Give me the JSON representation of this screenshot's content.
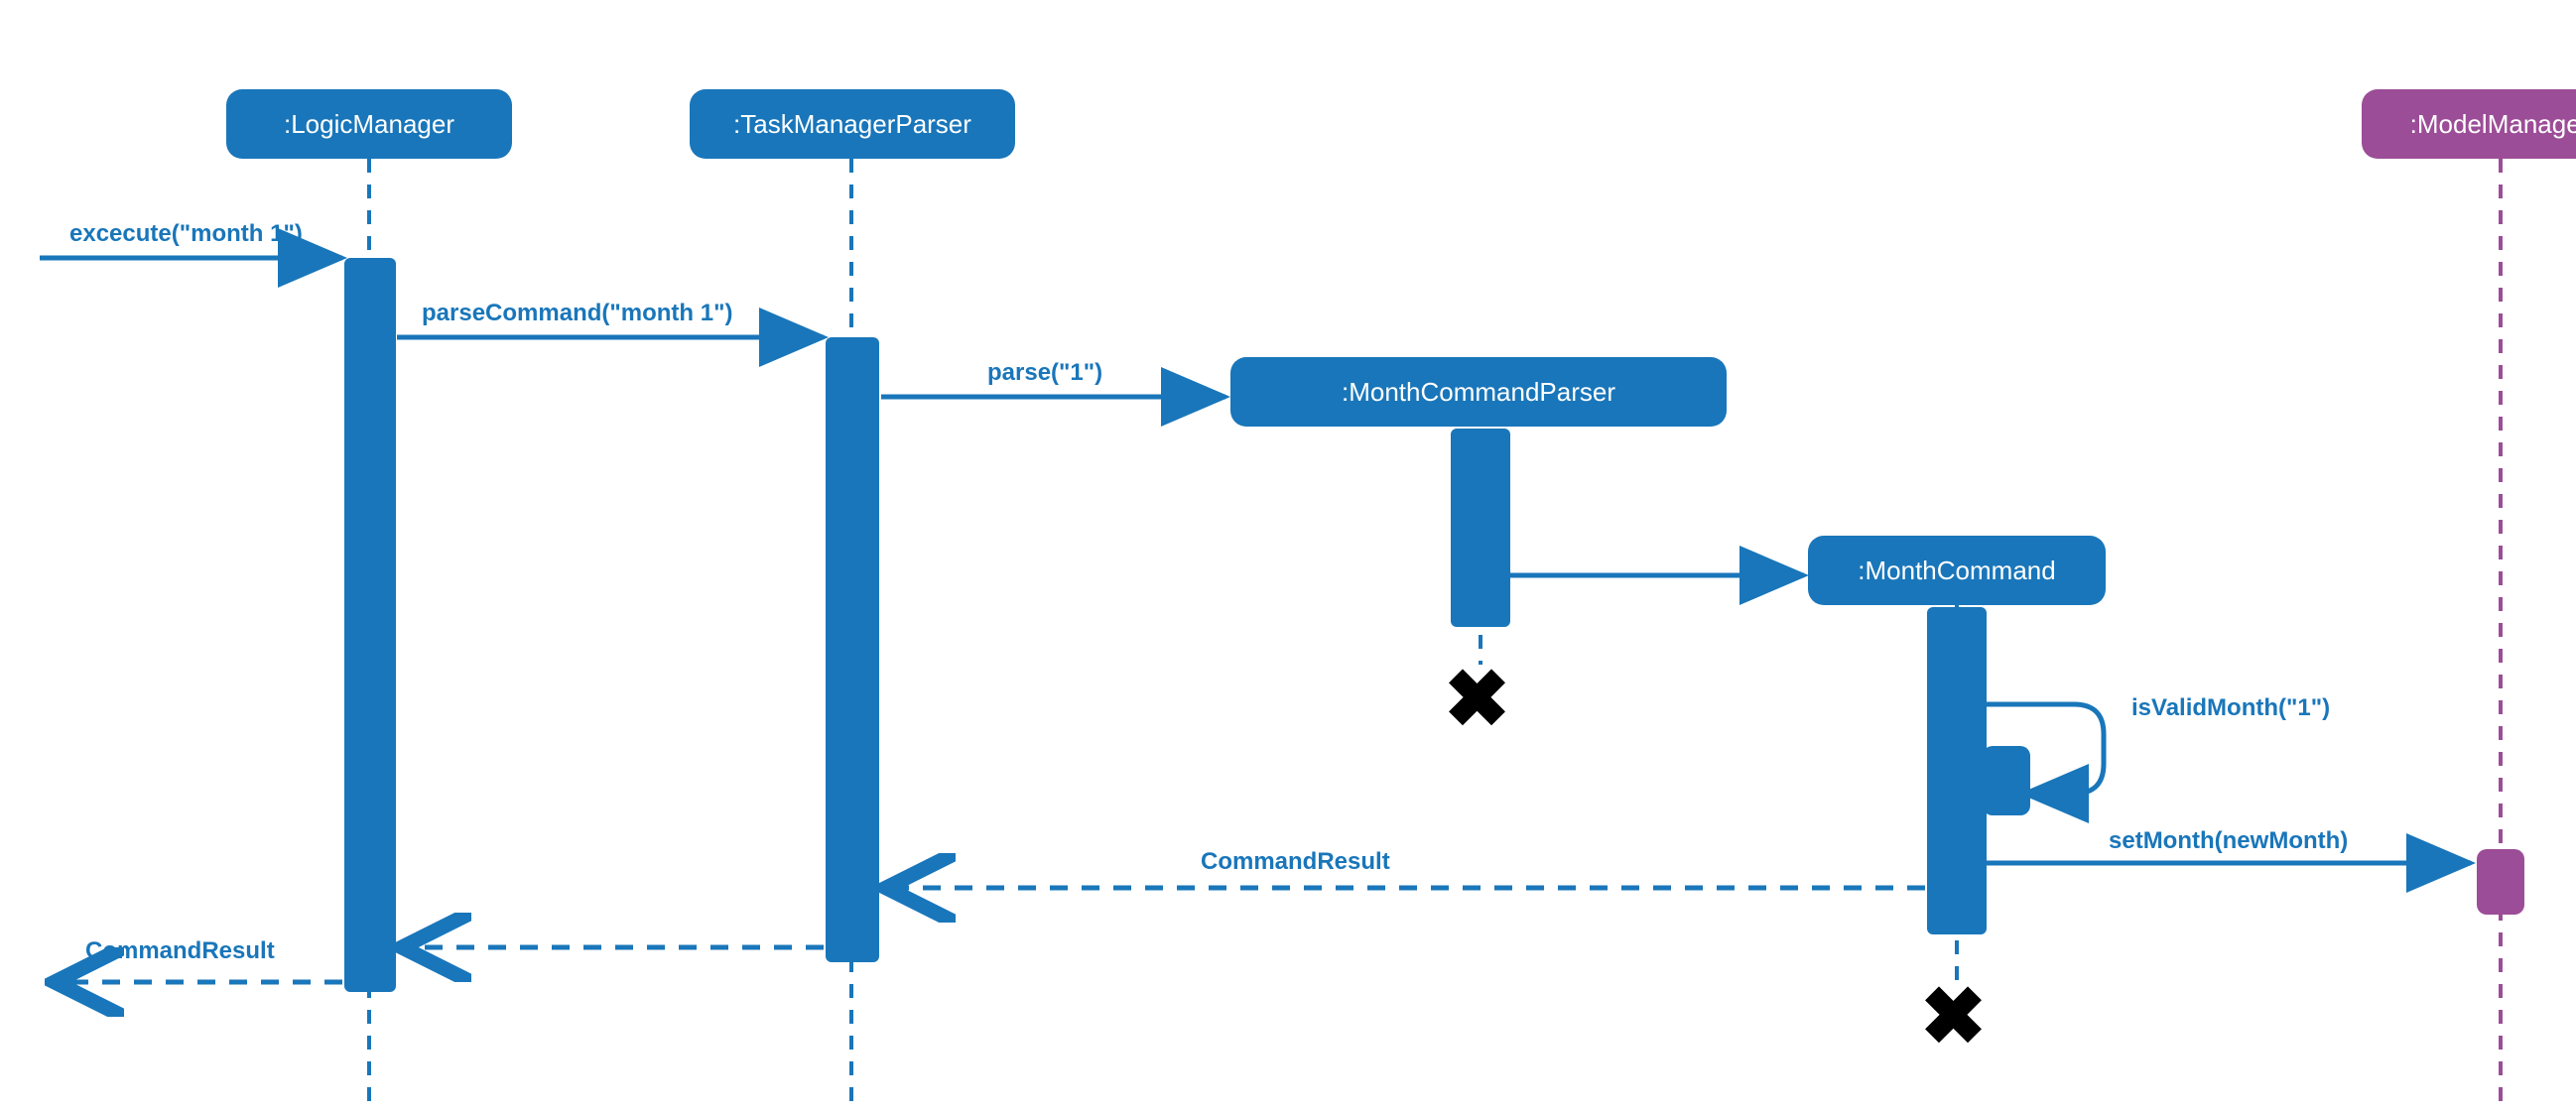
{
  "participants": {
    "logic": ":LogicManager",
    "parser": ":TaskManagerParser",
    "monthParser": ":MonthCommandParser",
    "monthCmd": ":MonthCommand",
    "model": ":ModelManager"
  },
  "messages": {
    "execute": "excecute(\"month 1\")",
    "parseCommand": "parseCommand(\"month 1\")",
    "parse": "parse(\"1\")",
    "isValidMonth": "isValidMonth(\"1\")",
    "setMonth": "setMonth(newMonth)",
    "commandResult1": "CommandResult",
    "commandResult2": "CommandResult"
  },
  "colors": {
    "blue": "#1976ba",
    "purple": "#9c4d97"
  }
}
